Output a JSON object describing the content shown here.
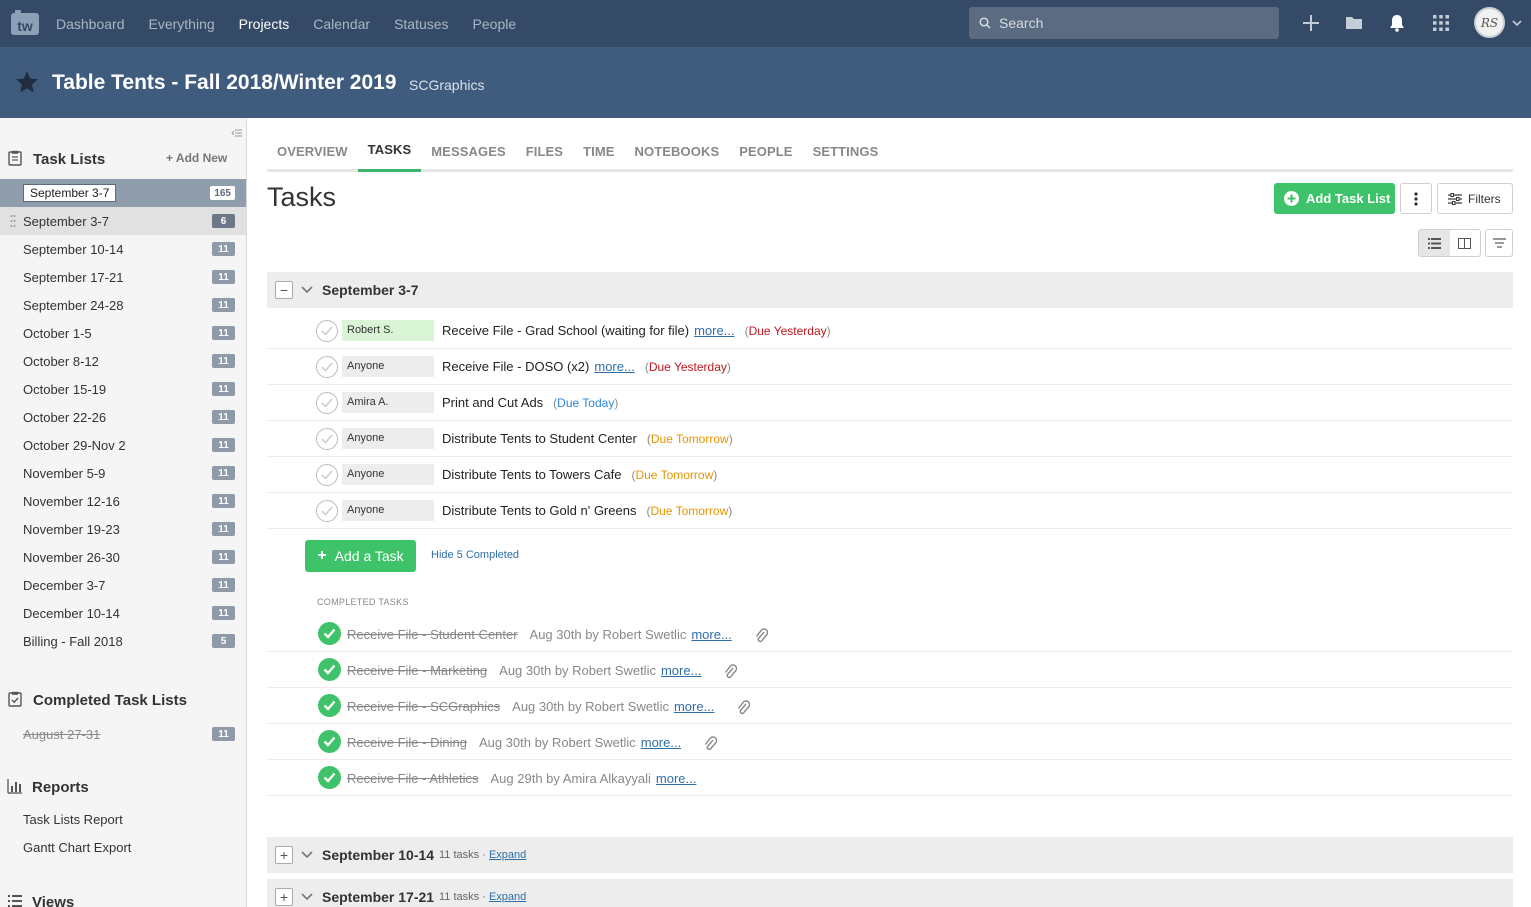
{
  "nav": {
    "items": [
      {
        "label": "Dashboard",
        "active": false
      },
      {
        "label": "Everything",
        "active": false
      },
      {
        "label": "Projects",
        "active": true
      },
      {
        "label": "Calendar",
        "active": false
      },
      {
        "label": "Statuses",
        "active": false
      },
      {
        "label": "People",
        "active": false
      }
    ],
    "search_placeholder": "Search",
    "avatar_initials": "RS"
  },
  "project": {
    "title": "Table Tents - Fall 2018/Winter 2019",
    "company": "SCGraphics"
  },
  "sidebar": {
    "task_lists_title": "Task Lists",
    "add_new": "Add New",
    "dragging_label": "September 3-7",
    "dragging_count": "165",
    "items": [
      {
        "label": "September 3-7",
        "count": "6"
      },
      {
        "label": "September 10-14",
        "count": "11"
      },
      {
        "label": "September 17-21",
        "count": "11"
      },
      {
        "label": "September 24-28",
        "count": "11"
      },
      {
        "label": "October 1-5",
        "count": "11"
      },
      {
        "label": "October 8-12",
        "count": "11"
      },
      {
        "label": "October 15-19",
        "count": "11"
      },
      {
        "label": "October 22-26",
        "count": "11"
      },
      {
        "label": "October 29-Nov 2",
        "count": "11"
      },
      {
        "label": "November 5-9",
        "count": "11"
      },
      {
        "label": "November 12-16",
        "count": "11"
      },
      {
        "label": "November 19-23",
        "count": "11"
      },
      {
        "label": "November 26-30",
        "count": "11"
      },
      {
        "label": "December 3-7",
        "count": "11"
      },
      {
        "label": "December 10-14",
        "count": "11"
      },
      {
        "label": "Billing - Fall 2018",
        "count": "5"
      }
    ],
    "completed_title": "Completed Task Lists",
    "completed_items": [
      {
        "label": "August 27-31",
        "count": "11"
      }
    ],
    "reports_title": "Reports",
    "reports": [
      "Task Lists Report",
      "Gantt Chart Export"
    ],
    "views_title": "Views"
  },
  "tabs": [
    "OVERVIEW",
    "TASKS",
    "MESSAGES",
    "FILES",
    "TIME",
    "NOTEBOOKS",
    "PEOPLE",
    "SETTINGS"
  ],
  "active_tab": "TASKS",
  "main": {
    "title": "Tasks",
    "add_task_list": "Add Task List",
    "filters": "Filters",
    "open_list": {
      "name": "September 3-7",
      "tasks": [
        {
          "assignee": "Robert S.",
          "highlight": true,
          "text": "Receive File - Grad School (waiting for file)",
          "more": "more...",
          "due": "Due Yesterday",
          "due_color": "#c0171e"
        },
        {
          "assignee": "Anyone",
          "highlight": false,
          "text": "Receive File - DOSO (x2)",
          "more": "more...",
          "due": "Due Yesterday",
          "due_color": "#c0171e"
        },
        {
          "assignee": "Amira A.",
          "highlight": false,
          "text": "Print and Cut Ads",
          "more": "",
          "due": "Due Today",
          "due_color": "#2d88d6"
        },
        {
          "assignee": "Anyone",
          "highlight": false,
          "text": "Distribute Tents to Student Center",
          "more": "",
          "due": "Due Tomorrow",
          "due_color": "#e69500"
        },
        {
          "assignee": "Anyone",
          "highlight": false,
          "text": "Distribute Tents to Towers Cafe",
          "more": "",
          "due": "Due Tomorrow",
          "due_color": "#e69500"
        },
        {
          "assignee": "Anyone",
          "highlight": false,
          "text": "Distribute Tents to Gold n' Greens",
          "more": "",
          "due": "Due Tomorrow",
          "due_color": "#e69500"
        }
      ],
      "add_task": "Add a Task",
      "hide_completed": "Hide 5 Completed",
      "completed_label": "COMPLETED TASKS",
      "completed": [
        {
          "name": "Receive File - Student Center",
          "by": "Aug 30th by Robert Swetlic",
          "more": "more...",
          "attachment": true
        },
        {
          "name": "Receive File - Marketing",
          "by": "Aug 30th by Robert Swetlic",
          "more": "more...",
          "attachment": true
        },
        {
          "name": "Receive File - SCGraphics",
          "by": "Aug 30th by Robert Swetlic",
          "more": "more...",
          "attachment": true
        },
        {
          "name": "Receive File - Dining",
          "by": "Aug 30th by Robert Swetlic",
          "more": "more...",
          "attachment": true
        },
        {
          "name": "Receive File - Athletics",
          "by": "Aug 29th by Amira Alkayyali",
          "more": "more...",
          "attachment": false
        }
      ]
    },
    "collapsed_lists": [
      {
        "name": "September 10-14",
        "count": "11 tasks",
        "sep": "·",
        "expand": "Expand"
      },
      {
        "name": "September 17-21",
        "count": "11 tasks",
        "sep": "·",
        "expand": "Expand"
      }
    ]
  },
  "colors": {
    "nav_bg": "#354a66",
    "header_bg": "#3f5b7e",
    "accent_green": "#3ec36a",
    "link": "#2f6fa8"
  }
}
